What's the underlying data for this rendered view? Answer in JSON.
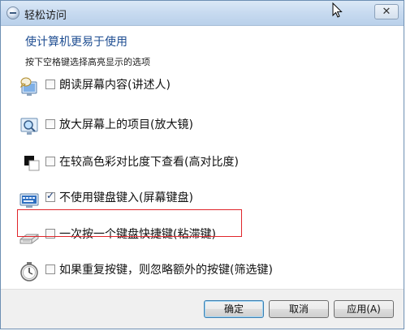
{
  "window": {
    "title": "轻松访问",
    "close_glyph": "✕"
  },
  "heading": "使计算机更易于使用",
  "subtext": "按下空格键选择高亮显示的选项",
  "options": [
    {
      "label": "朗读屏幕内容(讲述人)",
      "checked": false,
      "icon": "narrator-icon"
    },
    {
      "label": "放大屏幕上的项目(放大镜)",
      "checked": false,
      "icon": "magnifier-icon"
    },
    {
      "label": "在较高色彩对比度下查看(高对比度)",
      "checked": false,
      "icon": "high-contrast-icon"
    },
    {
      "label": "不使用键盘键入(屏幕键盘)",
      "checked": true,
      "icon": "on-screen-keyboard-icon"
    },
    {
      "label": "一次按一个键盘快捷键(粘滞键)",
      "checked": false,
      "icon": "sticky-keys-icon"
    },
    {
      "label": "如果重复按键，则忽略额外的按键(筛选键)",
      "checked": false,
      "icon": "filter-keys-icon"
    }
  ],
  "buttons": {
    "ok": "确定",
    "cancel": "取消",
    "apply": "应用(A)"
  },
  "colors": {
    "heading": "#1f4e92",
    "highlight_border": "#e0252a"
  }
}
